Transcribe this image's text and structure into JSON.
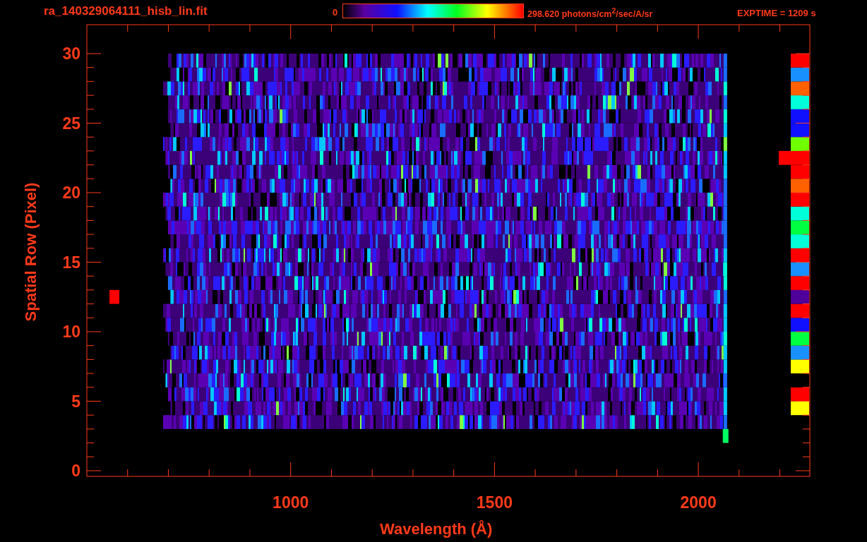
{
  "title": "ra_140329064111_hisb_lin.fit",
  "colorbar": {
    "min_label": "0",
    "max_label": "298.620 photons/cm$^{2}$/sec/A/sr"
  },
  "exposure": "EXPTIME = 1209 s",
  "plot": {
    "xlabel": "Wavelength (Å)",
    "ylabel": "Spatial Row (Pixel)",
    "xticks": [
      "1000",
      "1500",
      "2000"
    ],
    "yticks": [
      "30",
      "25",
      "20",
      "15",
      "10",
      "5",
      "0"
    ]
  }
}
